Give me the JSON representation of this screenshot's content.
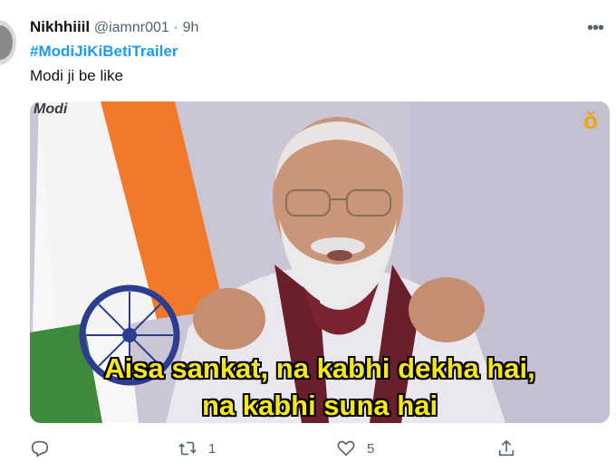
{
  "tweet": {
    "name": "Nikhhiiil",
    "handle": "@iamnr001",
    "separator": "·",
    "time": "9h",
    "more": "•••",
    "hashtag": "#ModiJiKiBetiTrailer",
    "text": "Modi ji be like"
  },
  "media": {
    "watermark": "Modi",
    "corner_logo": "ŏ",
    "subtitle_line1": "Aisa sankat, na kabhi dekha hai,",
    "subtitle_line2": "na kabhi suna hai"
  },
  "actions": {
    "reply_icon": "reply-icon",
    "retweet_icon": "retweet-icon",
    "retweet_count": "1",
    "like_icon": "heart-icon",
    "like_count": "5",
    "share_icon": "share-icon"
  },
  "colors": {
    "link": "#1d9bf0",
    "muted": "#536471",
    "subtitle": "#f6e71a"
  }
}
